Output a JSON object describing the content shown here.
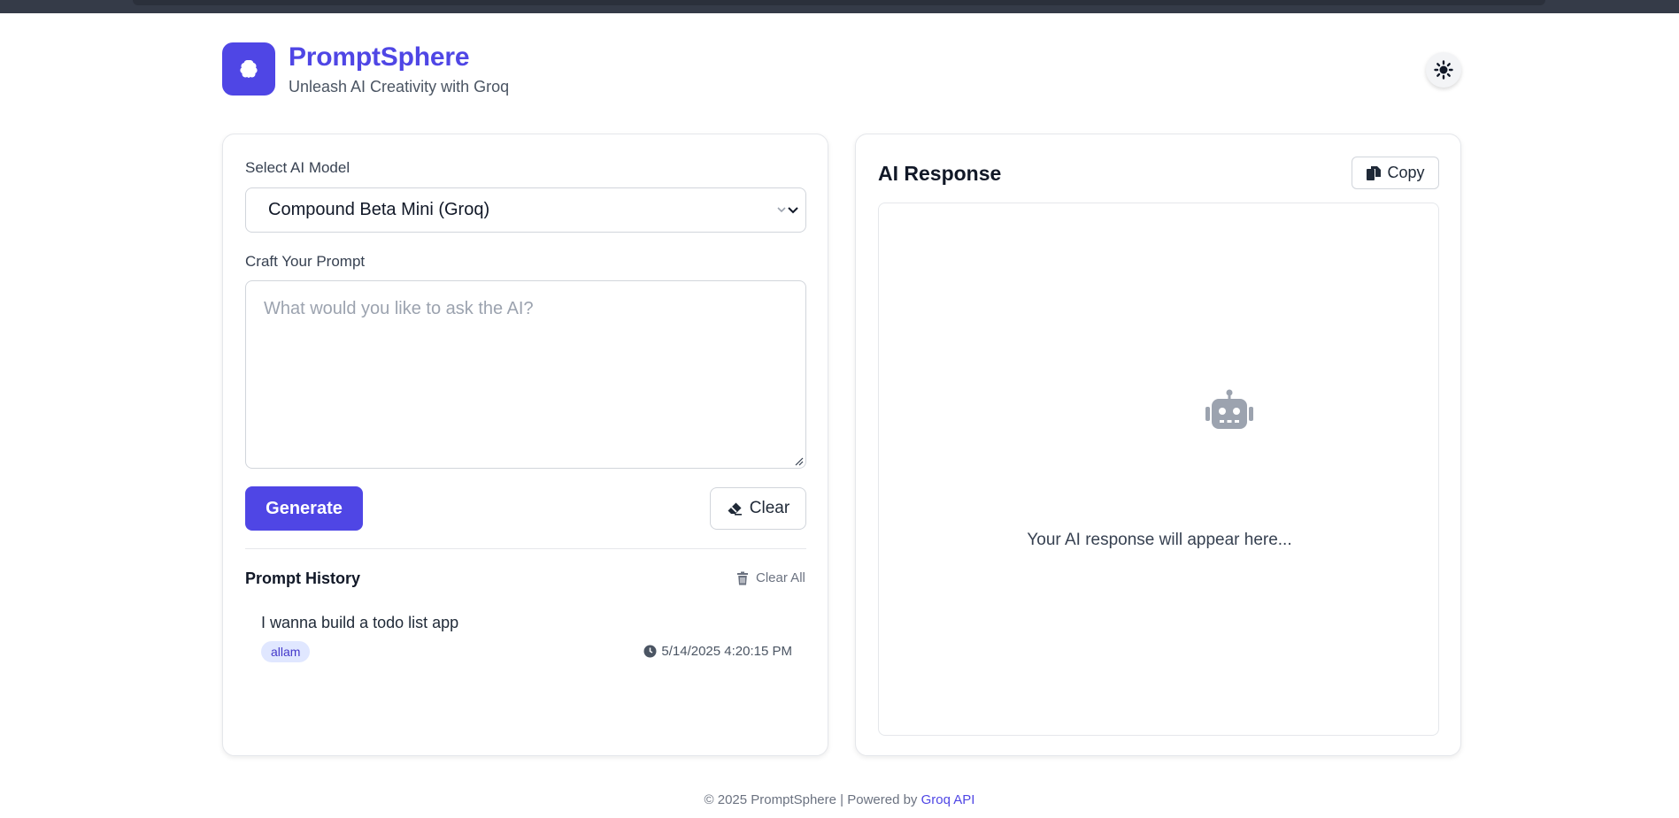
{
  "header": {
    "title": "PromptSphere",
    "subtitle": "Unleash AI Creativity with Groq",
    "logo_icon": "brain-icon",
    "theme_icon": "sun-icon"
  },
  "form": {
    "model_label": "Select AI Model",
    "model_selected": "Compound Beta Mini (Groq)",
    "prompt_label": "Craft Your Prompt",
    "prompt_placeholder": "What would you like to ask the AI?",
    "generate_label": "Generate",
    "clear_label": "Clear"
  },
  "history": {
    "title": "Prompt History",
    "clear_all_label": "Clear All",
    "items": [
      {
        "text": "I wanna build a todo list app",
        "model": "allam",
        "timestamp": "5/14/2025 4:20:15 PM"
      }
    ]
  },
  "response": {
    "title": "AI Response",
    "copy_label": "Copy",
    "placeholder": "Your AI response will appear here..."
  },
  "footer": {
    "text": "© 2025 PromptSphere | Powered by",
    "link_label": "Groq API"
  },
  "colors": {
    "accent": "#4f46e5",
    "badge_bg": "#e0e7ff",
    "muted": "#9ca3af"
  }
}
